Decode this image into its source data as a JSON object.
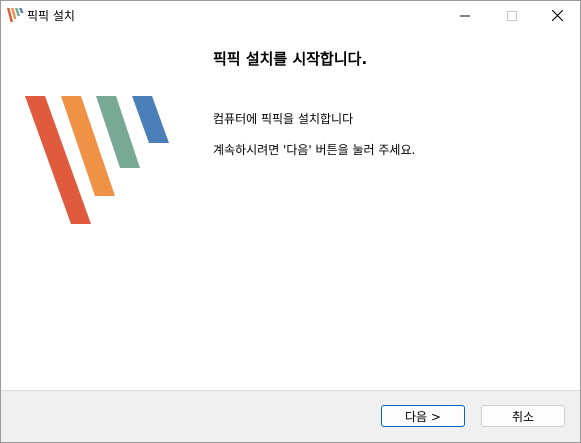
{
  "window": {
    "title": "픽픽 설치"
  },
  "main": {
    "heading": "픽픽 설치를 시작합니다.",
    "line1": "컴퓨터에 픽픽을 설치합니다",
    "line2": "계속하시려면 '다음' 버튼을 눌러 주세요."
  },
  "footer": {
    "next_label": "다음 >",
    "cancel_label": "취소"
  },
  "colors": {
    "logo_red": "#e05a3e",
    "logo_orange": "#ef9245",
    "logo_green": "#78a896",
    "logo_blue": "#4a7fba",
    "accent": "#0067c0"
  }
}
